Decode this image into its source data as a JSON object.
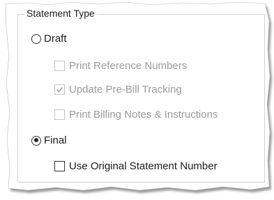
{
  "group": {
    "title": "Statement Type"
  },
  "options": {
    "draft": {
      "label": "Draft",
      "selected": false
    },
    "print_reference": {
      "label": "Print Reference Numbers",
      "checked": false,
      "enabled": false
    },
    "update_prebill": {
      "label": "Update Pre-Bill Tracking",
      "checked": true,
      "enabled": false
    },
    "print_billing_notes": {
      "label": "Print Billing Notes & Instructions",
      "checked": false,
      "enabled": false
    },
    "final": {
      "label": "Final",
      "selected": true
    },
    "use_original": {
      "label": "Use Original Statement Number",
      "checked": false,
      "enabled": true
    }
  }
}
